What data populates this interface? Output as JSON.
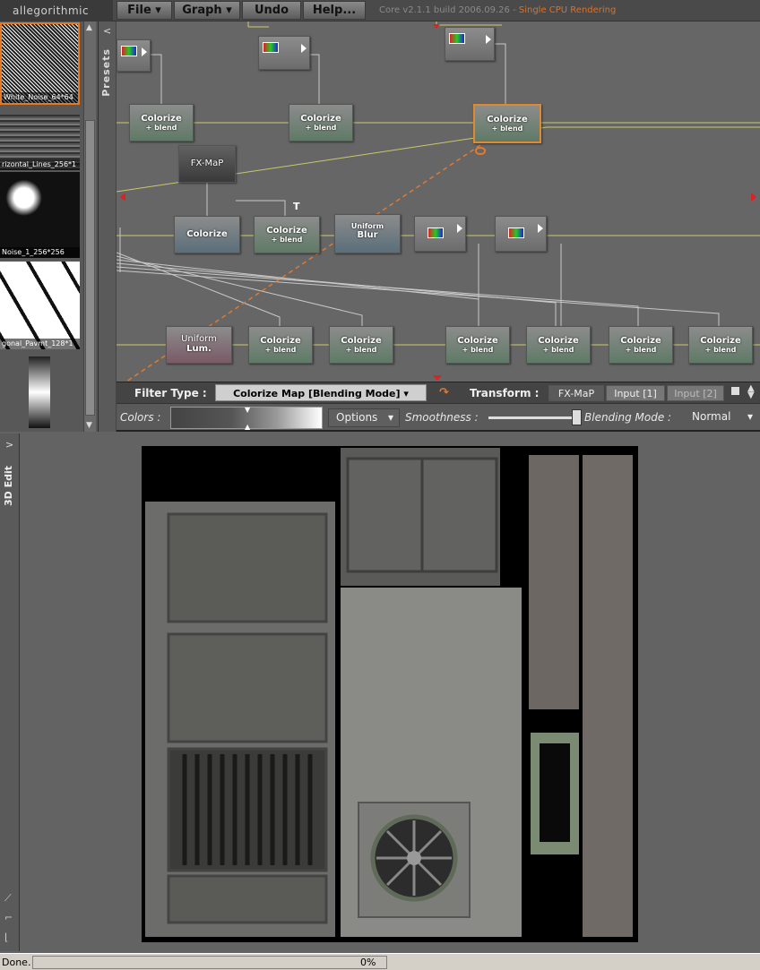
{
  "app": {
    "logo": "allegorithmic",
    "version": "Core v2.1.1 build 2006.09.26 -",
    "render_mode": "Single CPU Rendering"
  },
  "menu": [
    {
      "label": "File"
    },
    {
      "label": "Graph"
    },
    {
      "label": "Undo"
    },
    {
      "label": "Help..."
    }
  ],
  "presets": {
    "tab_label": "Presets",
    "items": [
      {
        "label": "White_Noise_64*64"
      },
      {
        "label": "rizontal_Lines_256*1"
      },
      {
        "label": "Noise_1_256*256"
      },
      {
        "label": "gonal_Pavmt_128*1"
      }
    ]
  },
  "nodes": {
    "colorize_blend": "Colorize",
    "blend_sub": "+ blend",
    "fxmap": "FX-MaP",
    "colorize": "Colorize",
    "uniform": "Uniform",
    "blur": "Blur",
    "lum": "Lum.",
    "t_marker": "T"
  },
  "filter_bar": {
    "filter_type_label": "Filter Type :",
    "filter_type_value": "Colorize Map [Blending Mode]",
    "transform_label": "Transform :",
    "tabs": [
      "FX-MaP",
      "Input [1]",
      "Input [2]"
    ]
  },
  "params": {
    "colors_label": "Colors :",
    "options_label": "Options",
    "smoothness_label": "Smoothness :",
    "smoothness_value": 1.0,
    "blending_mode_label": "Blending Mode :",
    "blending_mode_value": "Normal"
  },
  "view": {
    "tab_label": "3D Edit"
  },
  "status": {
    "text": "Done.",
    "progress_label": "0%",
    "progress": 0
  }
}
